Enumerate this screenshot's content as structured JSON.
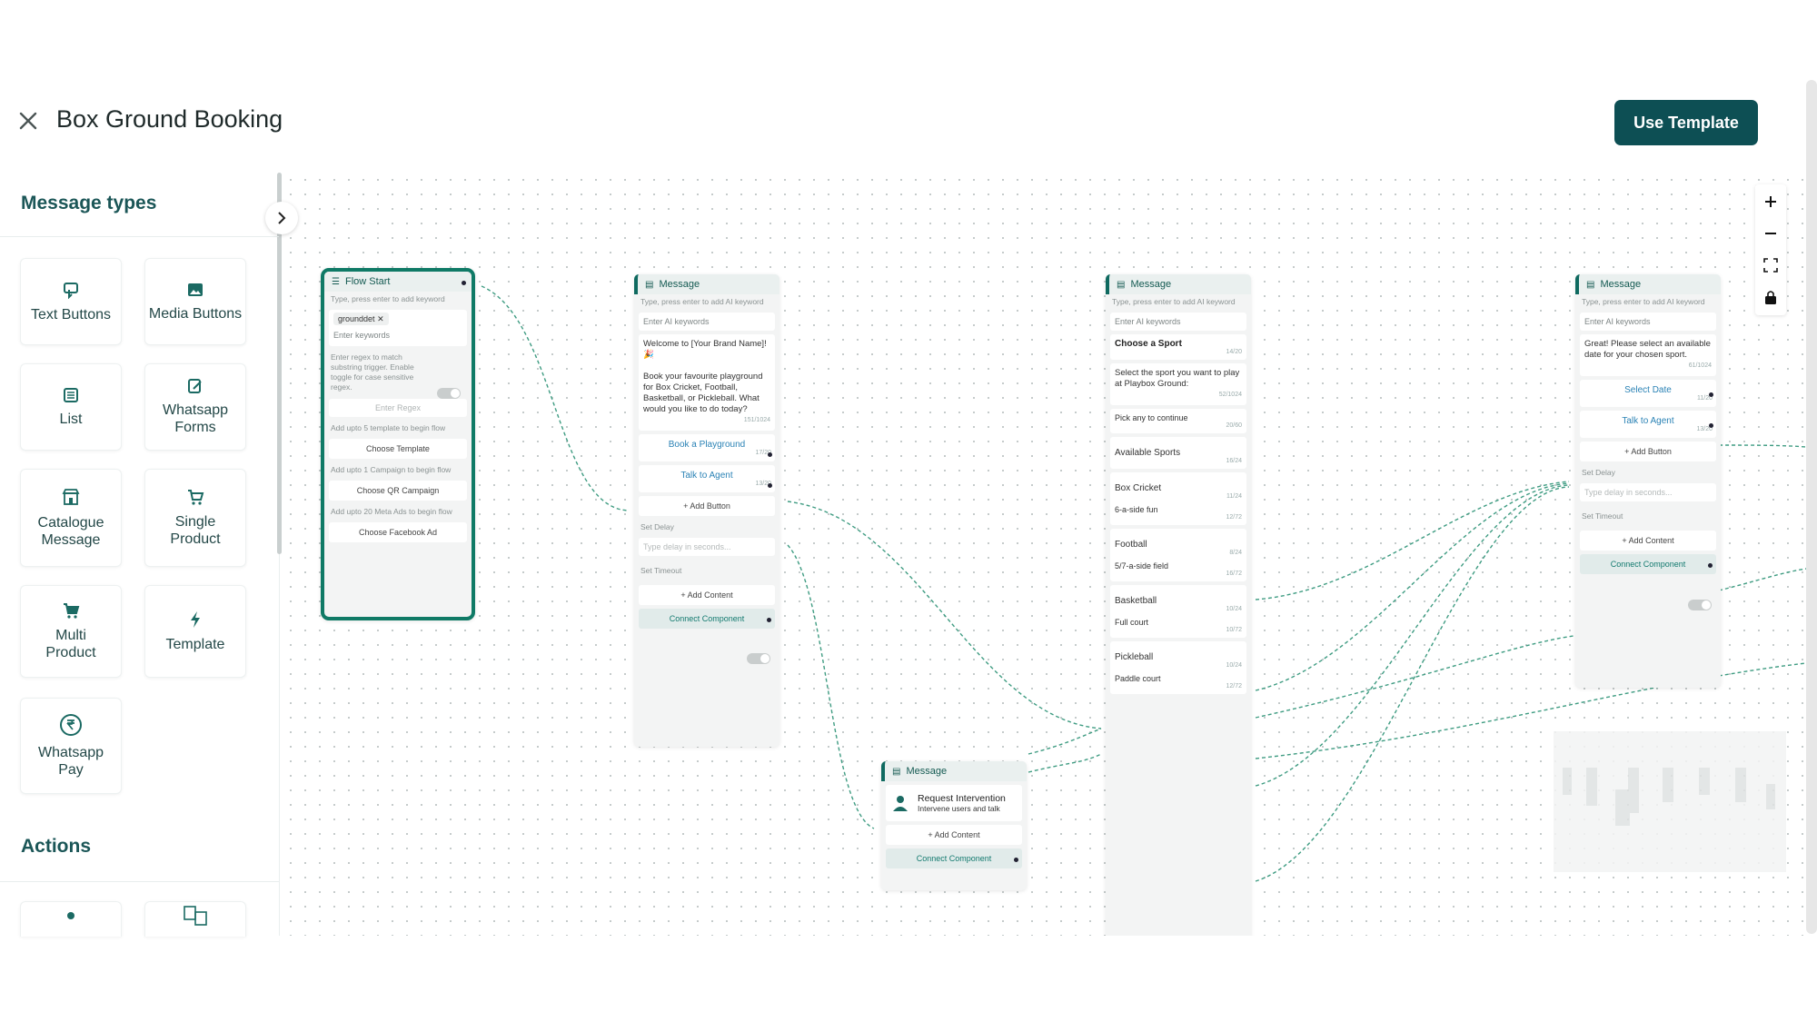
{
  "header": {
    "title": "Box Ground Booking",
    "use_template_label": "Use Template",
    "close_icon": "close-icon"
  },
  "sidebar": {
    "message_types_title": "Message types",
    "tiles": [
      {
        "label": "Text Buttons",
        "icon": "text-buttons-icon"
      },
      {
        "label": "Media Buttons",
        "icon": "image-icon"
      },
      {
        "label": "List",
        "icon": "list-icon"
      },
      {
        "label": "Whatsapp Forms",
        "icon": "form-icon"
      },
      {
        "label": "Catalogue Message",
        "icon": "catalogue-icon"
      },
      {
        "label": "Single Product",
        "icon": "cart-icon"
      },
      {
        "label": "Multi Product",
        "icon": "cart-icon"
      },
      {
        "label": "Template",
        "icon": "bolt-icon"
      },
      {
        "label": "Whatsapp Pay",
        "icon": "rupee-icon"
      }
    ],
    "actions_title": "Actions"
  },
  "canvas": {
    "flow_start": {
      "title": "Flow Start",
      "keyword_hint": "Type, press enter to add keyword",
      "keyword_chip": "grounddet",
      "keyword_placeholder": "Enter keywords",
      "regex_hint": "Enter regex to match substring trigger. Enable toggle for case sensitive regex.",
      "regex_placeholder": "Enter Regex",
      "template_hint": "Add upto 5 template to begin flow",
      "template_btn": "Choose Template",
      "campaign_hint": "Add upto 1 Campaign to begin flow",
      "campaign_btn": "Choose QR Campaign",
      "ads_hint": "Add upto 20 Meta Ads to begin flow",
      "ads_btn": "Choose Facebook Ad"
    },
    "message1": {
      "title": "Message",
      "ai_hint": "Type, press enter to add AI keyword",
      "ai_placeholder": "Enter AI keywords",
      "body": "Welcome to [Your Brand Name]! 🎉\n\nBook your favourite playground for Box Cricket, Football, Basketball, or Pickleball. What would you like to do today?",
      "body_count": "151/1024",
      "buttons": [
        {
          "label": "Book a Playground",
          "count": "17/20"
        },
        {
          "label": "Talk to Agent",
          "count": "13/20"
        }
      ],
      "add_button": "+ Add Button",
      "set_delay": "Set Delay",
      "delay_placeholder": "Type delay in seconds...",
      "set_timeout": "Set Timeout",
      "add_content": "+ Add Content",
      "connect": "Connect Component"
    },
    "message2": {
      "title": "Message",
      "ai_hint": "Type, press enter to add AI keyword",
      "ai_placeholder": "Enter AI keywords",
      "header_text": "Choose a Sport",
      "header_count": "14/20",
      "body": "Select the sport you want to play at Playbox Ground:",
      "body_count": "52/1024",
      "footer": "Pick any to continue",
      "footer_count": "20/60",
      "section": "Available Sports",
      "section_count": "16/24",
      "rows": [
        {
          "title": "Box Cricket",
          "title_count": "11/24",
          "desc": "6-a-side fun",
          "desc_count": "12/72"
        },
        {
          "title": "Football",
          "title_count": "8/24",
          "desc": "5/7-a-side field",
          "desc_count": "16/72"
        },
        {
          "title": "Basketball",
          "title_count": "10/24",
          "desc": "Full court",
          "desc_count": "10/72"
        },
        {
          "title": "Pickleball",
          "title_count": "10/24",
          "desc": "Paddle court",
          "desc_count": "12/72"
        }
      ]
    },
    "message3": {
      "title": "Message",
      "ai_hint": "Type, press enter to add AI keyword",
      "ai_placeholder": "Enter AI keywords",
      "body": "Great! Please select an available date for your chosen sport.",
      "body_count": "61/1024",
      "buttons": [
        {
          "label": "Select Date",
          "count": "11/20"
        },
        {
          "label": "Talk to Agent",
          "count": "13/20"
        }
      ],
      "add_button": "+ Add Button",
      "set_delay": "Set Delay",
      "delay_placeholder": "Type delay in seconds...",
      "set_timeout": "Set Timeout",
      "add_content": "+ Add Content",
      "connect": "Connect Component"
    },
    "message4": {
      "title": "Message",
      "intervention_title": "Request Intervention",
      "intervention_sub": "Intervene users and talk",
      "add_content": "+ Add Content",
      "connect": "Connect Component"
    }
  },
  "colors": {
    "accent": "#0d4f54",
    "node_accent": "#0f6a60",
    "link_blue": "#2a82b5",
    "wire": "#3f9c82"
  }
}
